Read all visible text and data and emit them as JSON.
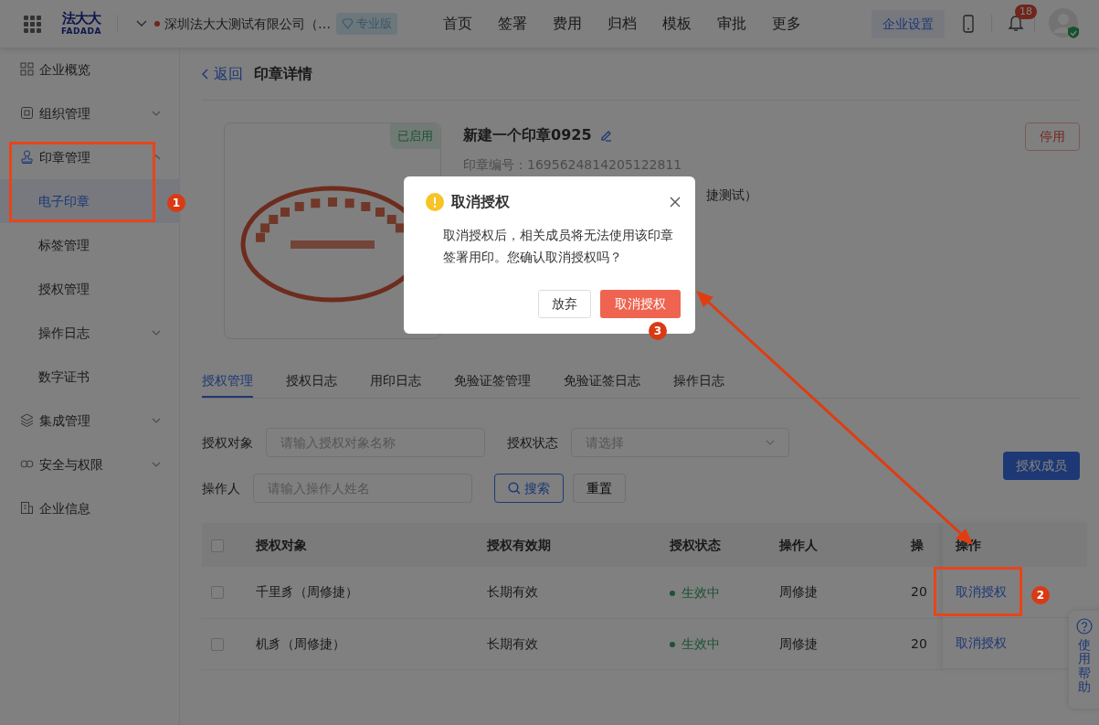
{
  "header": {
    "logo": {
      "cn": "法大大",
      "en": "FADADA"
    },
    "company": "深圳法大大测试有限公司（…",
    "plan_badge": "专业版",
    "nav": [
      {
        "label": "首页"
      },
      {
        "label": "签署"
      },
      {
        "label": "费用"
      },
      {
        "label": "归档"
      },
      {
        "label": "模板"
      },
      {
        "label": "审批"
      },
      {
        "label": "更多"
      }
    ],
    "settings_button": "企业设置",
    "notification_count": "18"
  },
  "sidebar": {
    "items": [
      {
        "label": "企业概览",
        "selected": false
      },
      {
        "label": "组织管理",
        "selected": false,
        "expanded": false
      },
      {
        "label": "印章管理",
        "selected": false,
        "expanded": true,
        "children": [
          {
            "label": "电子印章",
            "selected": true
          },
          {
            "label": "标签管理",
            "selected": false
          },
          {
            "label": "授权管理",
            "selected": false
          },
          {
            "label": "操作日志",
            "selected": false,
            "expanded": false
          },
          {
            "label": "数字证书",
            "selected": false
          }
        ]
      },
      {
        "label": "集成管理",
        "selected": false,
        "expanded": false
      },
      {
        "label": "安全与权限",
        "selected": false,
        "expanded": false
      },
      {
        "label": "企业信息",
        "selected": false
      }
    ]
  },
  "breadcrumb": {
    "back": "返回",
    "title": "印章详情"
  },
  "seal": {
    "status": "已启用",
    "name": "新建一个印章0925",
    "number": "印章编号：1695624814205122811",
    "partial_line": "捷测试）",
    "disable_button": "停用"
  },
  "tabs": [
    {
      "label": "授权管理",
      "selected": true
    },
    {
      "label": "授权日志",
      "selected": false
    },
    {
      "label": "用印日志",
      "selected": false
    },
    {
      "label": "免验证签管理",
      "selected": false
    },
    {
      "label": "免验证签日志",
      "selected": false
    },
    {
      "label": "操作日志",
      "selected": false
    }
  ],
  "filters": [
    {
      "label": "授权对象",
      "placeholder": "请输入授权对象名称",
      "kind": "text"
    },
    {
      "label": "授权状态",
      "placeholder": "请选择",
      "kind": "select"
    },
    {
      "label": "操作人",
      "placeholder": "请输入操作人姓名",
      "kind": "text"
    }
  ],
  "search_button": "搜索",
  "reset_button": "重置",
  "add_button": "授权成员",
  "table": {
    "header_checked": false,
    "columns": [
      "授权对象",
      "授权有效期",
      "授权状态",
      "操作人",
      "操",
      "操作"
    ],
    "rows": [
      {
        "checked": false,
        "cells": [
          "千里豸（周修捷）",
          "长期有效",
          "生效中",
          "周修捷",
          "20",
          "取消授权"
        ]
      },
      {
        "checked": false,
        "cells": [
          "机豸（周修捷）",
          "长期有效",
          "生效中",
          "周修捷",
          "20",
          "取消授权"
        ]
      }
    ]
  },
  "help": "使用帮助",
  "modal": {
    "title": "取消授权",
    "message": "取消授权后，相关成员将无法使用该印章签署用印。您确认取消授权吗？",
    "cancel_button": "放弃",
    "confirm_button": "取消授权"
  },
  "annotations": {
    "markers": [
      "1",
      "2",
      "3"
    ]
  }
}
